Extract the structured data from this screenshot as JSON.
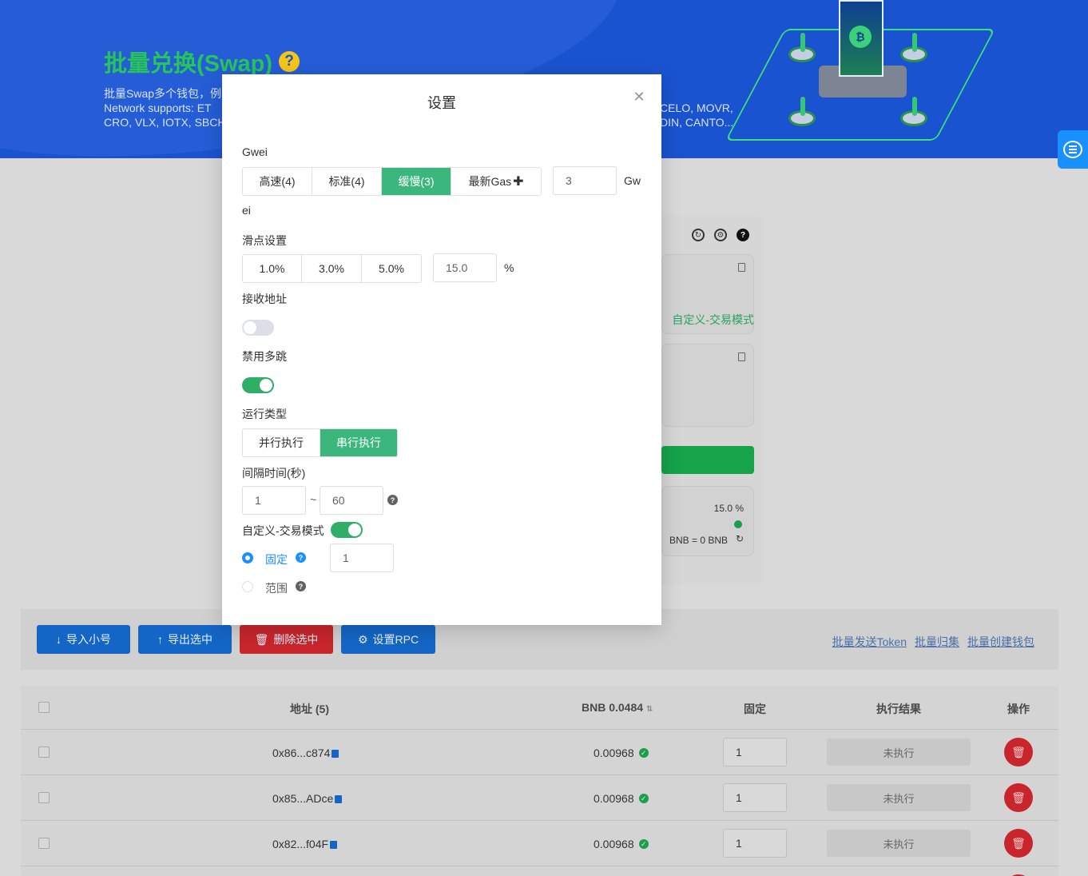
{
  "hero": {
    "title": "批量兑换(Swap)",
    "help_badge": "?",
    "desc_line1": "批量Swap多个钱包，例",
    "desc_line2": "Network supports:  ET",
    "desc_line3": "CRO, VLX, IOTX, SBCH",
    "desc_right_line1": "CELO, MOVR,",
    "desc_right_line2": "DIN, CANTO..."
  },
  "right_panel": {
    "custom_mode_text": "自定义-交易模式",
    "slippage_value": "15.0 %",
    "balance_text": "BNB = 0 BNB"
  },
  "toolbar": {
    "import_label": "导入小号",
    "export_label": "导出选中",
    "delete_label": "删除选中",
    "rpc_label": "设置RPC",
    "links": [
      "批量发送Token",
      "批量归集",
      "批量创建钱包"
    ]
  },
  "table": {
    "headers": {
      "address": "地址 (5)",
      "balance": "BNB 0.0484",
      "fixed": "固定",
      "result": "执行结果",
      "action": "操作"
    },
    "rows": [
      {
        "address": "0x86...c874",
        "balance": "0.00968",
        "fixed": "1",
        "result": "未执行"
      },
      {
        "address": "0x85...ADce",
        "balance": "0.00968",
        "fixed": "1",
        "result": "未执行"
      },
      {
        "address": "0x82...f04F",
        "balance": "0.00968",
        "fixed": "1",
        "result": "未执行"
      }
    ]
  },
  "modal": {
    "title": "设置",
    "gwei": {
      "label": "Gwei",
      "options": [
        "高速(4)",
        "标准(4)",
        "缓慢(3)",
        "最新Gas"
      ],
      "selected": "缓慢(3)",
      "value": "3",
      "suffix_part1": "Gw",
      "suffix_part2": "ei"
    },
    "slippage": {
      "label": "滑点设置",
      "options": [
        "1.0%",
        "3.0%",
        "5.0%"
      ],
      "value": "15.0",
      "suffix": "%"
    },
    "receive_address": {
      "label": "接收地址",
      "enabled": false
    },
    "disable_multihop": {
      "label": "禁用多跳",
      "enabled": true
    },
    "run_type": {
      "label": "运行类型",
      "options": [
        "并行执行",
        "串行执行"
      ],
      "selected": "串行执行"
    },
    "interval": {
      "label": "间隔时间(秒)",
      "min": "1",
      "separator": "~",
      "max": "60"
    },
    "custom_mode": {
      "label": "自定义-交易模式",
      "enabled": true,
      "fixed_label": "固定",
      "range_label": "范围",
      "selected": "固定",
      "fixed_value": "1"
    }
  },
  "colors": {
    "hero_bg": "#1a53cf",
    "accent_green": "#3bb77e",
    "primary_blue": "#1466c6",
    "danger_red": "#c8262c"
  }
}
